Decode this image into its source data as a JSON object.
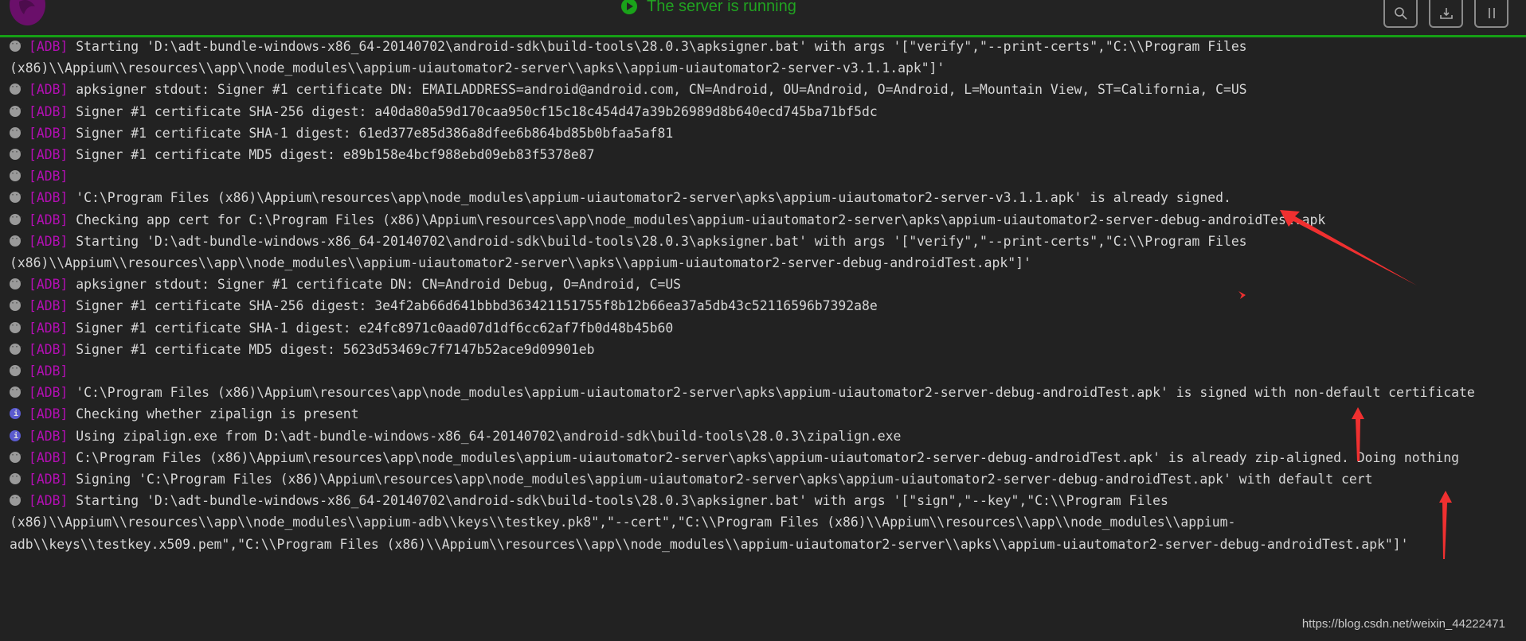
{
  "header": {
    "status_text": "The server is running",
    "status_color": "#21a321",
    "buttons": [
      {
        "name": "search",
        "icon": "search-icon"
      },
      {
        "name": "download-logs",
        "icon": "download-icon"
      },
      {
        "name": "pause",
        "icon": "pause-icon"
      }
    ]
  },
  "colors": {
    "background": "#222222",
    "tag": "#b30fb3",
    "text": "#d6d6d6",
    "accent_line": "#16a016",
    "annotation": "#f03030"
  },
  "log": [
    {
      "level": "debug",
      "tag": "[ADB]",
      "text": "Starting 'D:\\adt-bundle-windows-x86_64-20140702\\android-sdk\\build-tools\\28.0.3\\apksigner.bat' with args '[\"verify\",\"--print-certs\",\"C:\\\\Program Files (x86)\\\\Appium\\\\resources\\\\app\\\\node_modules\\\\appium-uiautomator2-server\\\\apks\\\\appium-uiautomator2-server-v3.1.1.apk\"]'"
    },
    {
      "level": "debug",
      "tag": "[ADB]",
      "text": "apksigner stdout: Signer #1 certificate DN: EMAILADDRESS=android@android.com, CN=Android, OU=Android, O=Android, L=Mountain View, ST=California, C=US"
    },
    {
      "level": "debug",
      "tag": "[ADB]",
      "text": "Signer #1 certificate SHA-256 digest: a40da80a59d170caa950cf15c18c454d47a39b26989d8b640ecd745ba71bf5dc"
    },
    {
      "level": "debug",
      "tag": "[ADB]",
      "text": "Signer #1 certificate SHA-1 digest: 61ed377e85d386a8dfee6b864bd85b0bfaa5af81"
    },
    {
      "level": "debug",
      "tag": "[ADB]",
      "text": "Signer #1 certificate MD5 digest: e89b158e4bcf988ebd09eb83f5378e87"
    },
    {
      "level": "debug",
      "tag": "[ADB]",
      "text": ""
    },
    {
      "level": "debug",
      "tag": "[ADB]",
      "text": "'C:\\Program Files (x86)\\Appium\\resources\\app\\node_modules\\appium-uiautomator2-server\\apks\\appium-uiautomator2-server-v3.1.1.apk' is already signed."
    },
    {
      "level": "debug",
      "tag": "[ADB]",
      "text": "Checking app cert for C:\\Program Files (x86)\\Appium\\resources\\app\\node_modules\\appium-uiautomator2-server\\apks\\appium-uiautomator2-server-debug-androidTest.apk"
    },
    {
      "level": "debug",
      "tag": "[ADB]",
      "text": "Starting 'D:\\adt-bundle-windows-x86_64-20140702\\android-sdk\\build-tools\\28.0.3\\apksigner.bat' with args '[\"verify\",\"--print-certs\",\"C:\\\\Program Files (x86)\\\\Appium\\\\resources\\\\app\\\\node_modules\\\\appium-uiautomator2-server\\\\apks\\\\appium-uiautomator2-server-debug-androidTest.apk\"]'"
    },
    {
      "level": "debug",
      "tag": "[ADB]",
      "text": "apksigner stdout: Signer #1 certificate DN: CN=Android Debug, O=Android, C=US"
    },
    {
      "level": "debug",
      "tag": "[ADB]",
      "text": "Signer #1 certificate SHA-256 digest: 3e4f2ab66d641bbbd363421151755f8b12b66ea37a5db43c52116596b7392a8e"
    },
    {
      "level": "debug",
      "tag": "[ADB]",
      "text": "Signer #1 certificate SHA-1 digest: e24fc8971c0aad07d1df6cc62af7fb0d48b45b60"
    },
    {
      "level": "debug",
      "tag": "[ADB]",
      "text": "Signer #1 certificate MD5 digest: 5623d53469c7f7147b52ace9d09901eb"
    },
    {
      "level": "debug",
      "tag": "[ADB]",
      "text": ""
    },
    {
      "level": "debug",
      "tag": "[ADB]",
      "text": "'C:\\Program Files (x86)\\Appium\\resources\\app\\node_modules\\appium-uiautomator2-server\\apks\\appium-uiautomator2-server-debug-androidTest.apk' is signed with non-default certificate"
    },
    {
      "level": "info",
      "tag": "[ADB]",
      "text": "Checking whether zipalign is present"
    },
    {
      "level": "info",
      "tag": "[ADB]",
      "text": "Using zipalign.exe from D:\\adt-bundle-windows-x86_64-20140702\\android-sdk\\build-tools\\28.0.3\\zipalign.exe"
    },
    {
      "level": "debug",
      "tag": "[ADB]",
      "text": "C:\\Program Files (x86)\\Appium\\resources\\app\\node_modules\\appium-uiautomator2-server\\apks\\appium-uiautomator2-server-debug-androidTest.apk' is already zip-aligned. Doing nothing"
    },
    {
      "level": "debug",
      "tag": "[ADB]",
      "text": "Signing 'C:\\Program Files (x86)\\Appium\\resources\\app\\node_modules\\appium-uiautomator2-server\\apks\\appium-uiautomator2-server-debug-androidTest.apk' with default cert"
    },
    {
      "level": "debug",
      "tag": "[ADB]",
      "text": "Starting 'D:\\adt-bundle-windows-x86_64-20140702\\android-sdk\\build-tools\\28.0.3\\apksigner.bat' with args '[\"sign\",\"--key\",\"C:\\\\Program Files (x86)\\\\Appium\\\\resources\\\\app\\\\node_modules\\\\appium-adb\\\\keys\\\\testkey.pk8\",\"--cert\",\"C:\\\\Program Files (x86)\\\\Appium\\\\resources\\\\app\\\\node_modules\\\\appium-adb\\\\keys\\\\testkey.x509.pem\",\"C:\\\\Program Files (x86)\\\\Appium\\\\resources\\\\app\\\\node_modules\\\\appium-uiautomator2-server\\\\apks\\\\appium-uiautomator2-server-debug-androidTest.apk\"]'"
    }
  ],
  "watermark": "https://blog.csdn.net/weixin_44222471"
}
